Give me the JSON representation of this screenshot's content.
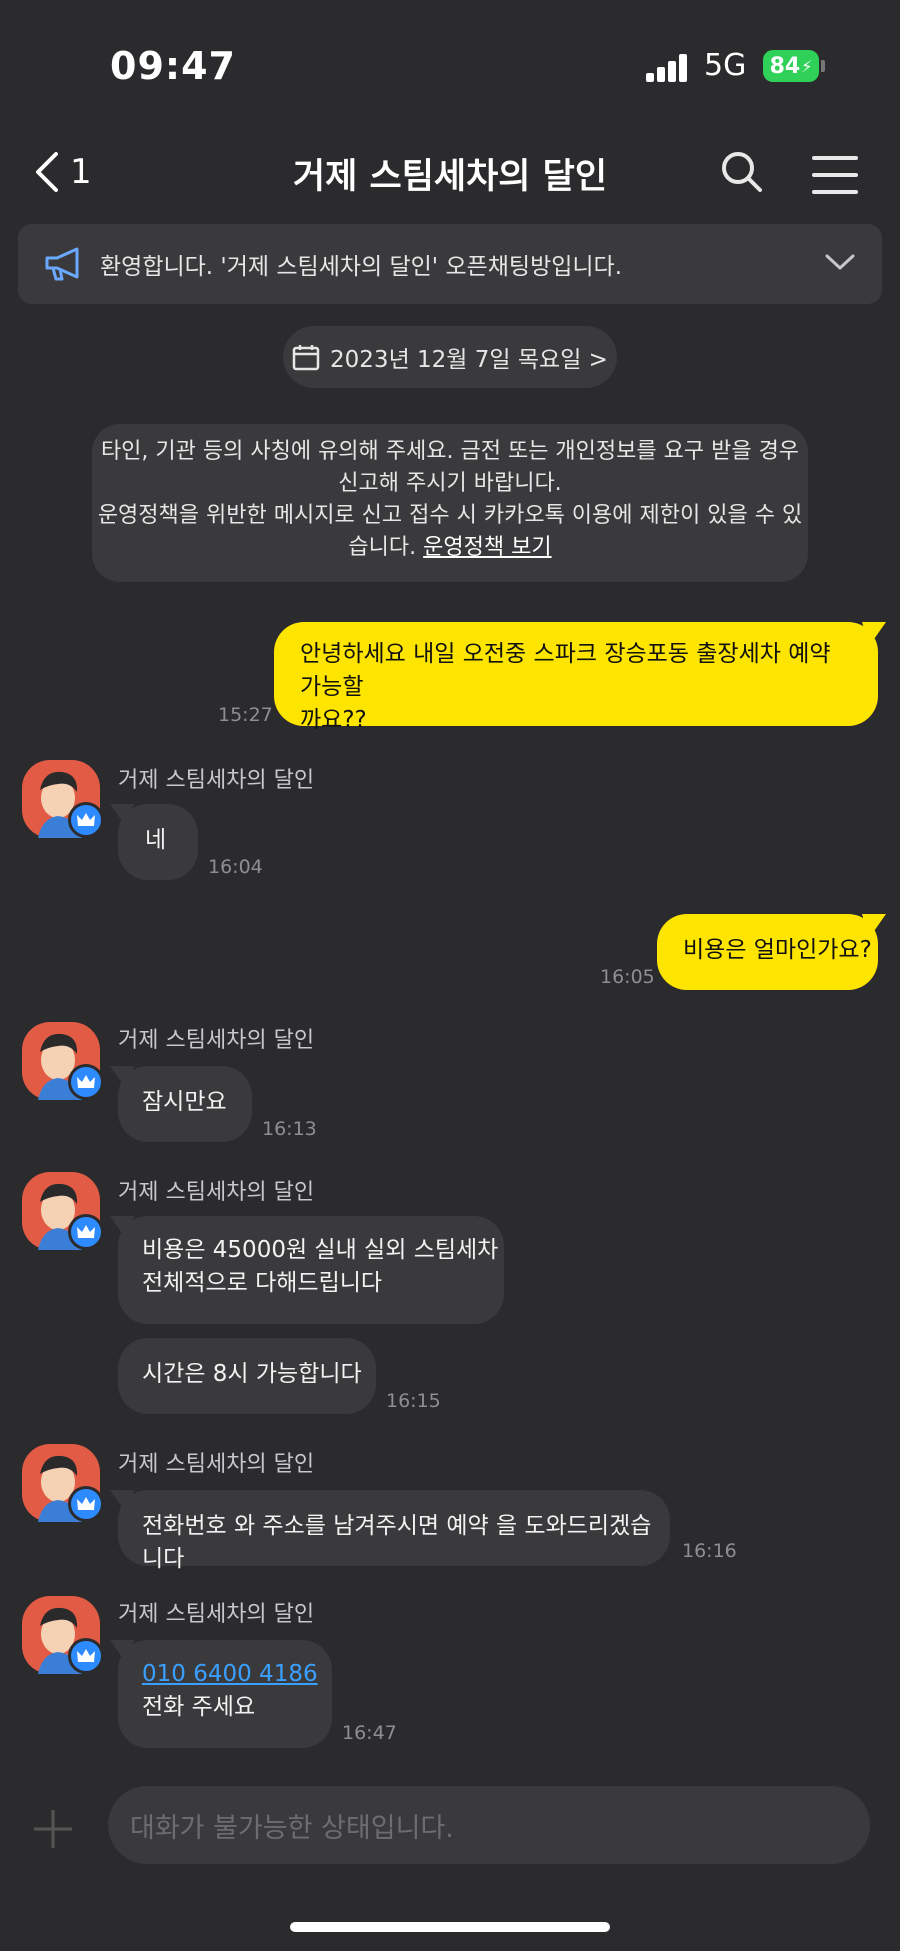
{
  "status": {
    "time": "09:47",
    "network": "5G",
    "battery": "84"
  },
  "header": {
    "back_count": "1",
    "title": "거제 스팀세차의 달인"
  },
  "notice": {
    "text": "환영합니다. '거제 스팀세차의 달인' 오픈채팅방입니다."
  },
  "date_divider": "2023년 12월 7일 목요일 >",
  "system_message": {
    "line1": "타인, 기관 등의 사칭에 유의해 주세요. 금전 또는 개인정보를 요구 받을 경우",
    "line2": "신고해 주시기 바랍니다.",
    "line3": "운영정책을 위반한 메시지로 신고 접수 시 카카오톡 이용에 제한이 있을 수 있",
    "line4_prefix": "습니다. ",
    "link": "운영정책 보기"
  },
  "messages": [
    {
      "from": "me",
      "line1": "안녕하세요 내일 오전중 스파크 장승포동 출장세차 예약 가능할",
      "line2": "까요??",
      "time": "15:27"
    },
    {
      "from": "them",
      "sender": "거제 스팀세차의 달인",
      "text": "네",
      "time": "16:04"
    },
    {
      "from": "me",
      "text": "비용은 얼마인가요?",
      "time": "16:05"
    },
    {
      "from": "them",
      "sender": "거제 스팀세차의 달인",
      "text": "잠시만요",
      "time": "16:13"
    },
    {
      "from": "them",
      "sender": "거제 스팀세차의 달인",
      "line1": "비용은 45000원 실내 실외 스팀세차",
      "line2": "전체적으로 다해드립니다"
    },
    {
      "from": "them",
      "text": "시간은 8시 가능합니다",
      "time": "16:15"
    },
    {
      "from": "them",
      "sender": "거제 스팀세차의 달인",
      "text": "전화번호 와 주소를 남겨주시면 예약 을 도와드리겠습니다",
      "time": "16:16"
    },
    {
      "from": "them",
      "sender": "거제 스팀세차의 달인",
      "phone": "010 6400 4186",
      "text": "전화 주세요",
      "time": "16:47"
    }
  ],
  "input": {
    "placeholder": "대화가 불가능한 상태입니다."
  },
  "colors": {
    "my_bubble": "#fee500",
    "their_bubble": "#3a3a3c",
    "background": "#2b2b2d",
    "link": "#3aa0ff",
    "avatar": "#e25b45",
    "badge": "#2e8bff"
  },
  "icons": [
    "back-chevron-icon",
    "search-icon",
    "menu-icon",
    "megaphone-icon",
    "chevron-down-icon",
    "calendar-icon",
    "crown-icon",
    "plus-icon"
  ]
}
